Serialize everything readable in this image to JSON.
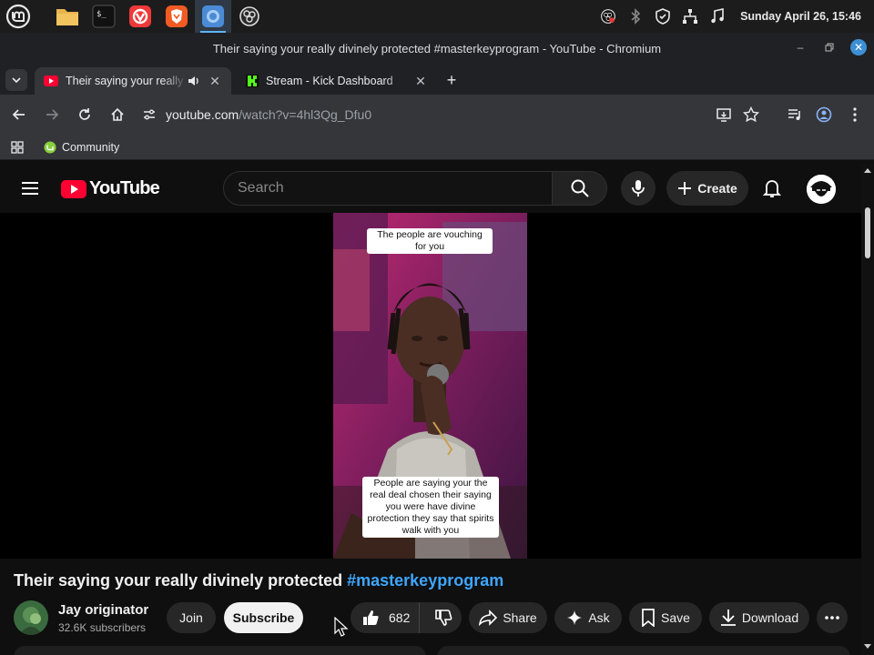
{
  "taskbar": {
    "apps": [
      {
        "name": "mint-menu-icon"
      },
      {
        "name": "files-icon"
      },
      {
        "name": "terminal-icon"
      },
      {
        "name": "vivaldi-icon"
      },
      {
        "name": "brave-icon"
      },
      {
        "name": "chromium-icon",
        "active": true
      },
      {
        "name": "obs-icon"
      }
    ],
    "clock": "Sunday April 26, 15:46"
  },
  "window": {
    "title": "Their saying your really divinely protected #masterkeyprogram - YouTube - Chromium"
  },
  "tabs": [
    {
      "title": "Their saying your really divinely protected #masterkeyprogram",
      "active": true
    },
    {
      "title": "Stream - Kick Dashboard",
      "active": false
    }
  ],
  "omnibox": {
    "host": "youtube.com",
    "path": "/watch?v=4hl3Qg_Dfu0"
  },
  "bookmarks": [
    {
      "label": "Community"
    }
  ],
  "youtube": {
    "logo_text": "YouTube",
    "search_placeholder": "Search",
    "create_label": "Create",
    "video": {
      "caption_top": "The people are vouching for you",
      "caption_bottom": "People are saying your the real deal chosen their saying you were have divine protection they say that spirits walk with you"
    },
    "title_main": "Their saying your really divinely protected ",
    "title_tag": "#masterkeyprogram",
    "channel": {
      "name": "Jay originator",
      "subscribers": "32.6K subscribers"
    },
    "actions": {
      "join": "Join",
      "subscribe": "Subscribe",
      "likes": "682",
      "share": "Share",
      "ask": "Ask",
      "save": "Save",
      "download": "Download"
    }
  },
  "colors": {
    "yt_red": "#ff0033",
    "link_blue": "#3ea6ff",
    "background": "#0f0f0f",
    "kick_green": "#53fc18"
  }
}
